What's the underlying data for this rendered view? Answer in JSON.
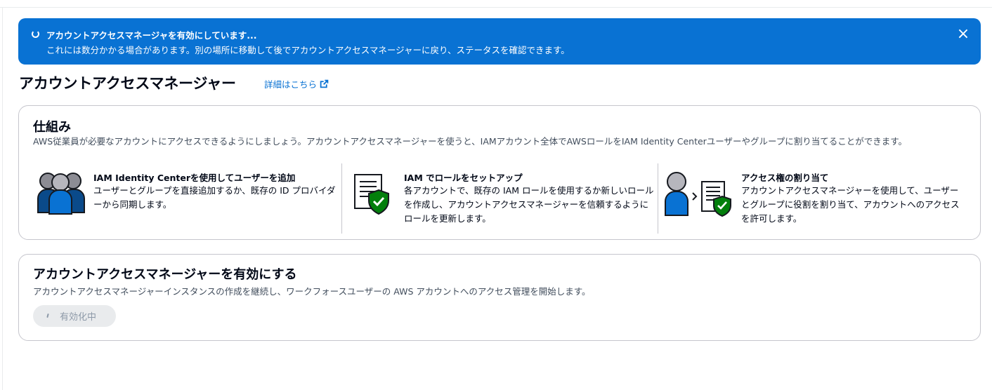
{
  "flash": {
    "title": "アカウントアクセスマネージャを有効にしています...",
    "body": "これには数分かかる場合があります。別の場所に移動して後でアカウントアクセスマネージャーに戻り、ステータスを確認できます。",
    "close_icon": "×",
    "color": "#0972d3"
  },
  "header": {
    "title": "アカウントアクセスマネージャー",
    "learn_more": "詳細はこちら"
  },
  "how_it_works": {
    "title": "仕組み",
    "description": "AWS従業員が必要なアカウントにアクセスできるようにしましょう。アカウントアクセスマネージャーを使うと、IAMアカウント全体でAWSロールをIAM Identity Centerユーザーやグループに割り当てることができます。",
    "steps": [
      {
        "title": "IAM Identity Centerを使用してユーザーを追加",
        "description": "ユーザーとグループを直接追加するか、既存の ID プロバイダーから同期します。",
        "icon": "users-group-icon"
      },
      {
        "title": "IAM でロールをセットアップ",
        "description": "各アカウントで、既存の IAM ロールを使用するか新しいロールを作成し、アカウントアクセスマネージャーを信頼するようにロールを更新します。",
        "icon": "document-shield-icon"
      },
      {
        "title": "アクセス権の割り当て",
        "description": "アカウントアクセスマネージャーを使用して、ユーザーとグループに役割を割り当て、アカウントへのアクセスを許可します。",
        "icon": "user-document-shield-icon"
      }
    ]
  },
  "enable": {
    "title": "アカウントアクセスマネージャーを有効にする",
    "description": "アカウントアクセスマネージャーインスタンスの作成を継続し、ワークフォースユーザーの AWS アカウントへのアクセス管理を開始します。",
    "button_label": "有効化中"
  },
  "colors": {
    "accent": "#0972d3",
    "shield": "#037f0c",
    "user_blue": "#0972d3",
    "user_gray": "#8c8c94"
  }
}
